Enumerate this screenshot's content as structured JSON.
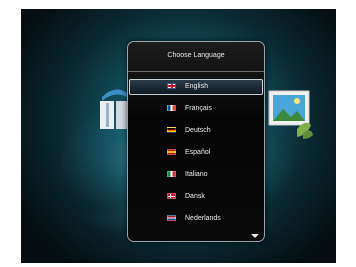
{
  "dialog": {
    "title": "Choose Language",
    "selected_index": 0
  },
  "languages": [
    {
      "label": "English",
      "flag_icon": "uk-flag-icon",
      "flag_colors": [
        "#c8102e",
        "#ffffff",
        "#012169"
      ]
    },
    {
      "label": "Français",
      "flag_icon": "france-flag-icon",
      "flag_colors": [
        "#0055a4",
        "#ffffff",
        "#ef4135"
      ]
    },
    {
      "label": "Deutsch",
      "flag_icon": "germany-flag-icon",
      "flag_colors": [
        "#000000",
        "#dd0000",
        "#ffce00"
      ]
    },
    {
      "label": "Español",
      "flag_icon": "spain-flag-icon",
      "flag_colors": [
        "#aa151b",
        "#f1bf00",
        "#aa151b"
      ]
    },
    {
      "label": "Italiano",
      "flag_icon": "italy-flag-icon",
      "flag_colors": [
        "#009246",
        "#ffffff",
        "#ce2b37"
      ]
    },
    {
      "label": "Dansk",
      "flag_icon": "denmark-flag-icon",
      "flag_colors": [
        "#c60c30",
        "#ffffff",
        "#c60c30"
      ]
    },
    {
      "label": "Nederlands",
      "flag_icon": "netherlands-flag-icon",
      "flag_colors": [
        "#ae1c28",
        "#ffffff",
        "#21468b"
      ]
    }
  ],
  "scroll": {
    "more_below": true,
    "icon": "scroll-down-arrow-icon"
  },
  "colors": {
    "background_glow": "#1f7a8e",
    "dialog_border": "#9aa3a8",
    "highlight_border": "#c8d4dc"
  }
}
